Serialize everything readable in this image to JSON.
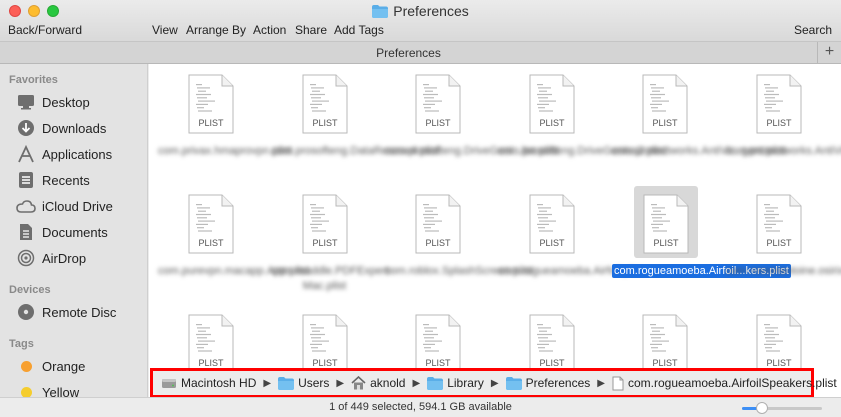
{
  "window": {
    "title": "Preferences",
    "folder_color": "#5aaee8"
  },
  "toolbar": {
    "back_forward": "Back/Forward",
    "view": "View",
    "arrange_by": "Arrange By",
    "action": "Action",
    "share": "Share",
    "add_tags": "Add Tags",
    "search": "Search"
  },
  "tabbar": {
    "title": "Preferences",
    "add": "+"
  },
  "sidebar": {
    "favorites_header": "Favorites",
    "favorites": [
      {
        "label": "Desktop",
        "icon": "desktop-icon"
      },
      {
        "label": "Downloads",
        "icon": "downloads-icon"
      },
      {
        "label": "Applications",
        "icon": "applications-icon"
      },
      {
        "label": "Recents",
        "icon": "recents-icon"
      },
      {
        "label": "iCloud Drive",
        "icon": "icloud-icon"
      },
      {
        "label": "Documents",
        "icon": "documents-icon"
      },
      {
        "label": "AirDrop",
        "icon": "airdrop-icon"
      }
    ],
    "devices_header": "Devices",
    "devices": [
      {
        "label": "Remote Disc",
        "icon": "disc-icon"
      }
    ],
    "tags_header": "Tags",
    "tags": [
      {
        "label": "Orange",
        "color": "#f7a030"
      },
      {
        "label": "Yellow",
        "color": "#f5cd2e"
      }
    ]
  },
  "files": [
    {
      "kind": "PLIST",
      "name": "com.privax.hmaprovpn.plist"
    },
    {
      "kind": "PLIST",
      "name": "com.prosofteng.DataRescue4.plist"
    },
    {
      "kind": "PLIST",
      "name": "com.prosofteng.DriveGeni...lse.plist"
    },
    {
      "kind": "PLIST",
      "name": "com.prosofteng.DriveGenius2.plist"
    },
    {
      "kind": "PLIST",
      "name": "com.protectworks.AntiVir...gent.plist"
    },
    {
      "kind": "PLIST",
      "name": "com.protectworks.AntiVirus.plist"
    },
    {
      "kind": "PLIST",
      "name": "com.purevpn.macapp.App.plist"
    },
    {
      "kind": "PLIST",
      "name": "com.readdle.PDFExpert-Mac.plist"
    },
    {
      "kind": "PLIST",
      "name": "com.roblox.SplashScreen.plist"
    },
    {
      "kind": "PLIST",
      "name": "com.rogueamoeba.Airfoil.plist"
    },
    {
      "kind": "PLIST",
      "name": "com.rogueamoeba.Airfoil...kers.plist",
      "selected": true
    },
    {
      "kind": "PLIST",
      "name": "com.rossetantoine.osirix.plist"
    },
    {
      "kind": "PLIST",
      "name": ""
    },
    {
      "kind": "PLIST",
      "name": ""
    },
    {
      "kind": "PLIST",
      "name": ""
    },
    {
      "kind": "PLIST",
      "name": ""
    },
    {
      "kind": "PLIST",
      "name": ""
    },
    {
      "kind": "PLIST",
      "name": ""
    }
  ],
  "pathbar": [
    {
      "label": "Macintosh HD",
      "icon": "hard-drive-icon"
    },
    {
      "label": "Users",
      "icon": "folder-icon"
    },
    {
      "label": "aknold",
      "icon": "home-icon"
    },
    {
      "label": "Library",
      "icon": "folder-icon"
    },
    {
      "label": "Preferences",
      "icon": "folder-icon"
    },
    {
      "label": "com.rogueamoeba.AirfoilSpeakers.plist",
      "icon": "file-icon"
    }
  ],
  "status": {
    "text": "1 of 449 selected, 594.1 GB available",
    "zoom_level": 0.25
  }
}
